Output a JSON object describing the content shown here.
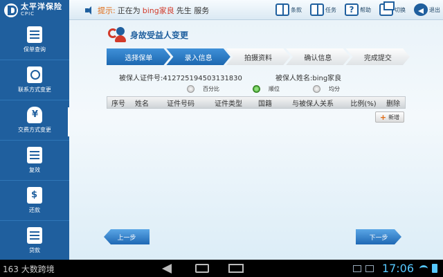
{
  "app": {
    "logo_cn": "太平洋保险",
    "logo_en": "CPIC"
  },
  "topbar": {
    "notice_label": "提示:",
    "notice_prefix": "正在为",
    "user_name": "bing家良",
    "notice_suffix": "先生 服务",
    "actions": [
      {
        "label": "条款",
        "icon": "book-icon"
      },
      {
        "label": "任务",
        "icon": "book-icon"
      },
      {
        "label": "帮助",
        "icon": "help-icon"
      },
      {
        "label": "切换",
        "icon": "switch-icon"
      },
      {
        "label": "退出",
        "icon": "exit-icon"
      }
    ]
  },
  "sidebar": {
    "items": [
      {
        "label": "保单查询",
        "icon": "document-icon"
      },
      {
        "label": "联系方式变更",
        "icon": "contact-icon"
      },
      {
        "label": "交费方式变更",
        "icon": "money-bag-icon"
      },
      {
        "label": "复效",
        "icon": "document-icon"
      },
      {
        "label": "还款",
        "icon": "dollar-document-icon"
      },
      {
        "label": "贷款",
        "icon": "loan-icon"
      }
    ]
  },
  "main": {
    "title": "身故受益人变更",
    "steps": [
      "选择保单",
      "录入信息",
      "拍摄资料",
      "确认信息",
      "完成提交"
    ],
    "active_step": 1,
    "insured_id_label": "被保人证件号:412725194503131830",
    "insured_name_label": "被保人姓名:bing家良",
    "radio_options": [
      {
        "label": "百分比",
        "selected": false
      },
      {
        "label": "顺位",
        "selected": true
      },
      {
        "label": "均分",
        "selected": false
      }
    ],
    "table_headers": [
      "序号",
      "姓名",
      "证件号码",
      "证件类型",
      "国籍",
      "与被保人关系",
      "比例(%)",
      "删除"
    ],
    "add_label": "新增",
    "prev_label": "上一步",
    "next_label": "下一步"
  },
  "system_bar": {
    "left_text": "163 大数跨境",
    "time": "17:06"
  },
  "colors": {
    "brand_blue": "#1f5f9e",
    "step_active": "#2a7cc7",
    "accent_orange": "#e06a12",
    "clock_blue": "#56c8ff"
  }
}
